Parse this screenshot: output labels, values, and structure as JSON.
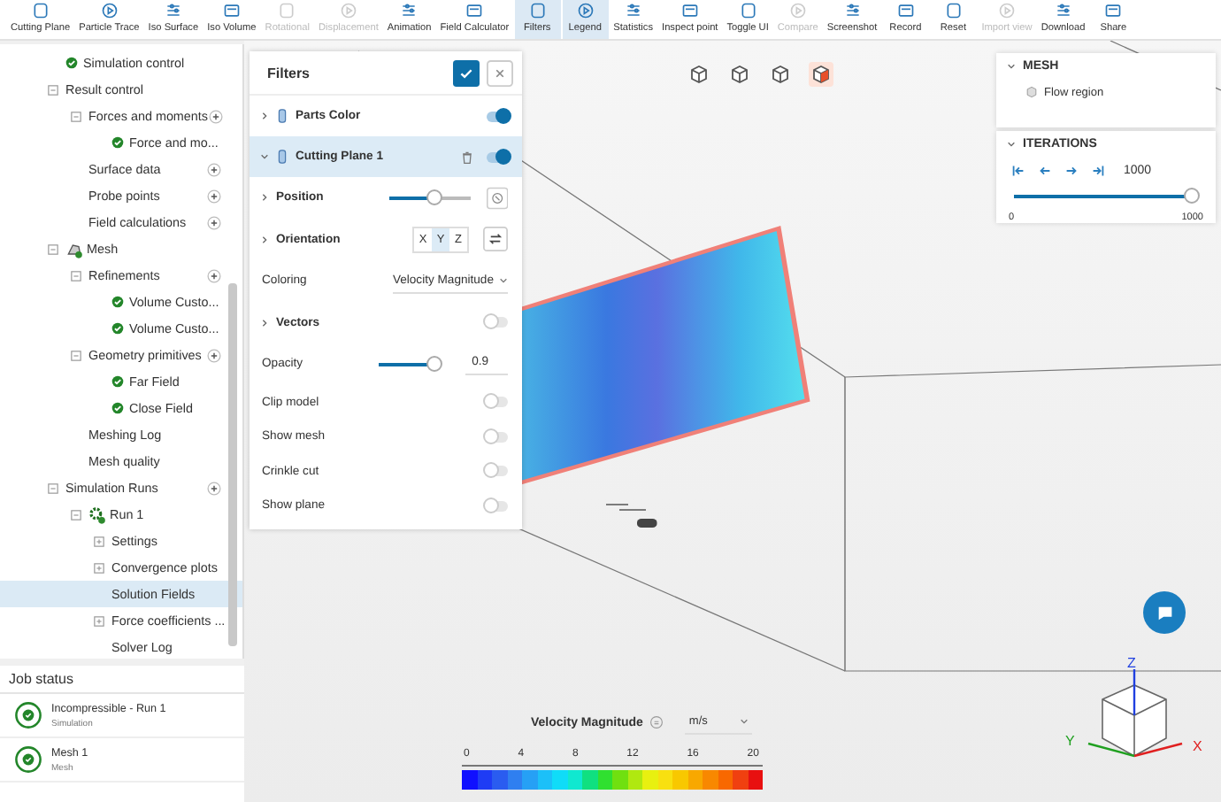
{
  "toolbar": {
    "items": [
      {
        "label": "Cutting Plane",
        "disabled": false,
        "selected": false
      },
      {
        "label": "Particle Trace",
        "disabled": false,
        "selected": false
      },
      {
        "label": "Iso Surface",
        "disabled": false,
        "selected": false
      },
      {
        "label": "Iso Volume",
        "disabled": false,
        "selected": false
      },
      {
        "label": "Rotational",
        "disabled": true,
        "selected": false
      },
      {
        "label": "Displacement",
        "disabled": true,
        "selected": false
      },
      {
        "label": "Animation",
        "disabled": false,
        "selected": false
      },
      {
        "label": "Field Calculator",
        "disabled": false,
        "selected": false
      },
      {
        "label": "Filters",
        "disabled": false,
        "selected": true
      },
      {
        "label": "Legend",
        "disabled": false,
        "selected": true
      },
      {
        "label": "Statistics",
        "disabled": false,
        "selected": false
      },
      {
        "label": "Inspect point",
        "disabled": false,
        "selected": false
      },
      {
        "label": "Toggle UI",
        "disabled": false,
        "selected": false
      },
      {
        "label": "Compare",
        "disabled": true,
        "selected": false
      },
      {
        "label": "Screenshot",
        "disabled": false,
        "selected": false
      },
      {
        "label": "Record",
        "disabled": false,
        "selected": false
      },
      {
        "label": "Reset",
        "disabled": false,
        "selected": false
      },
      {
        "label": "Import view",
        "disabled": true,
        "selected": false
      },
      {
        "label": "Download",
        "disabled": false,
        "selected": false
      },
      {
        "label": "Share",
        "disabled": false,
        "selected": false
      }
    ]
  },
  "tree": {
    "items": [
      {
        "label": "Simulation control",
        "check": true,
        "add": false,
        "selected": false
      },
      {
        "label": "Result control",
        "expanded": true,
        "check": false,
        "add": false,
        "selected": false,
        "children": [
          {
            "label": "Forces and moments",
            "expanded": true,
            "check": false,
            "add": true,
            "selected": false,
            "children": [
              {
                "label": "Force and mo...",
                "check": true,
                "add": false,
                "selected": false
              }
            ]
          },
          {
            "label": "Surface data",
            "check": false,
            "add": true,
            "selected": false
          },
          {
            "label": "Probe points",
            "check": false,
            "add": true,
            "selected": false
          },
          {
            "label": "Field calculations",
            "check": false,
            "add": true,
            "selected": false
          }
        ]
      },
      {
        "label": "Mesh",
        "kind": "mesh",
        "expanded": true,
        "check": false,
        "add": false,
        "selected": false,
        "children": [
          {
            "label": "Refinements",
            "expanded": true,
            "check": false,
            "add": true,
            "selected": false,
            "children": [
              {
                "label": "Volume Custo...",
                "check": true,
                "add": false,
                "selected": false
              },
              {
                "label": "Volume Custo...",
                "check": true,
                "add": false,
                "selected": false
              }
            ]
          },
          {
            "label": "Geometry primitives",
            "expanded": true,
            "check": false,
            "add": true,
            "selected": false,
            "children": [
              {
                "label": "Far Field",
                "check": true,
                "add": false,
                "selected": false
              },
              {
                "label": "Close Field",
                "check": true,
                "add": false,
                "selected": false
              }
            ]
          },
          {
            "label": "Meshing Log",
            "check": false,
            "add": false,
            "selected": false
          },
          {
            "label": "Mesh quality",
            "check": false,
            "add": false,
            "selected": false
          }
        ]
      },
      {
        "label": "Simulation Runs",
        "expanded": true,
        "check": false,
        "add": true,
        "selected": false,
        "children": [
          {
            "label": "Run 1",
            "kind": "run",
            "expanded": true,
            "check": false,
            "add": false,
            "selected": false,
            "children": [
              {
                "label": "Settings",
                "expanded": false,
                "check": false,
                "add": false,
                "selected": false
              },
              {
                "label": "Convergence plots",
                "expanded": false,
                "check": false,
                "add": false,
                "selected": false
              },
              {
                "label": "Solution Fields",
                "check": false,
                "add": false,
                "selected": true
              },
              {
                "label": "Force coefficients ...",
                "expanded": false,
                "check": false,
                "add": false,
                "selected": false
              },
              {
                "label": "Solver Log",
                "check": false,
                "add": false,
                "selected": false
              }
            ]
          }
        ]
      }
    ]
  },
  "job_status": {
    "title": "Job status",
    "jobs": [
      {
        "name": "Incompressible - Run 1",
        "type": "Simulation"
      },
      {
        "name": "Mesh 1",
        "type": "Mesh"
      }
    ]
  },
  "filters": {
    "title": "Filters",
    "filters": [
      {
        "label": "Parts Color",
        "expanded": false,
        "on": true,
        "selected": false
      },
      {
        "label": "Cutting Plane 1",
        "expanded": true,
        "on": true,
        "selected": true
      }
    ],
    "position": {
      "label": "Position",
      "level": 0.55
    },
    "orientation": {
      "label": "Orientation",
      "axes": [
        {
          "label": "X",
          "selected": false
        },
        {
          "label": "Y",
          "selected": true
        },
        {
          "label": "Z",
          "selected": false
        }
      ]
    },
    "coloring": {
      "label": "Coloring",
      "value": "Velocity Magnitude"
    },
    "vectors": {
      "label": "Vectors",
      "on": false
    },
    "opacity": {
      "label": "Opacity",
      "level": 0.9,
      "value": "0.9"
    },
    "switches": [
      {
        "label": "Clip model",
        "on": false
      },
      {
        "label": "Show mesh",
        "on": false
      },
      {
        "label": "Crinkle cut",
        "on": false
      },
      {
        "label": "Show plane",
        "on": false
      }
    ]
  },
  "view_buttons": [
    {
      "selected": false
    },
    {
      "selected": false
    },
    {
      "selected": false
    },
    {
      "selected": true
    }
  ],
  "mesh_panel": {
    "title": "MESH",
    "items": [
      "Flow region"
    ]
  },
  "iterations": {
    "title": "ITERATIONS",
    "value": "1000",
    "level": 1,
    "min": "0",
    "max": "1000"
  },
  "legend": {
    "title": "Velocity Magnitude",
    "unit": "m/s",
    "ticks": [
      "0",
      "4",
      "8",
      "12",
      "16",
      "20"
    ]
  },
  "axes": {
    "x": "X",
    "y": "Y",
    "z": "Z"
  }
}
